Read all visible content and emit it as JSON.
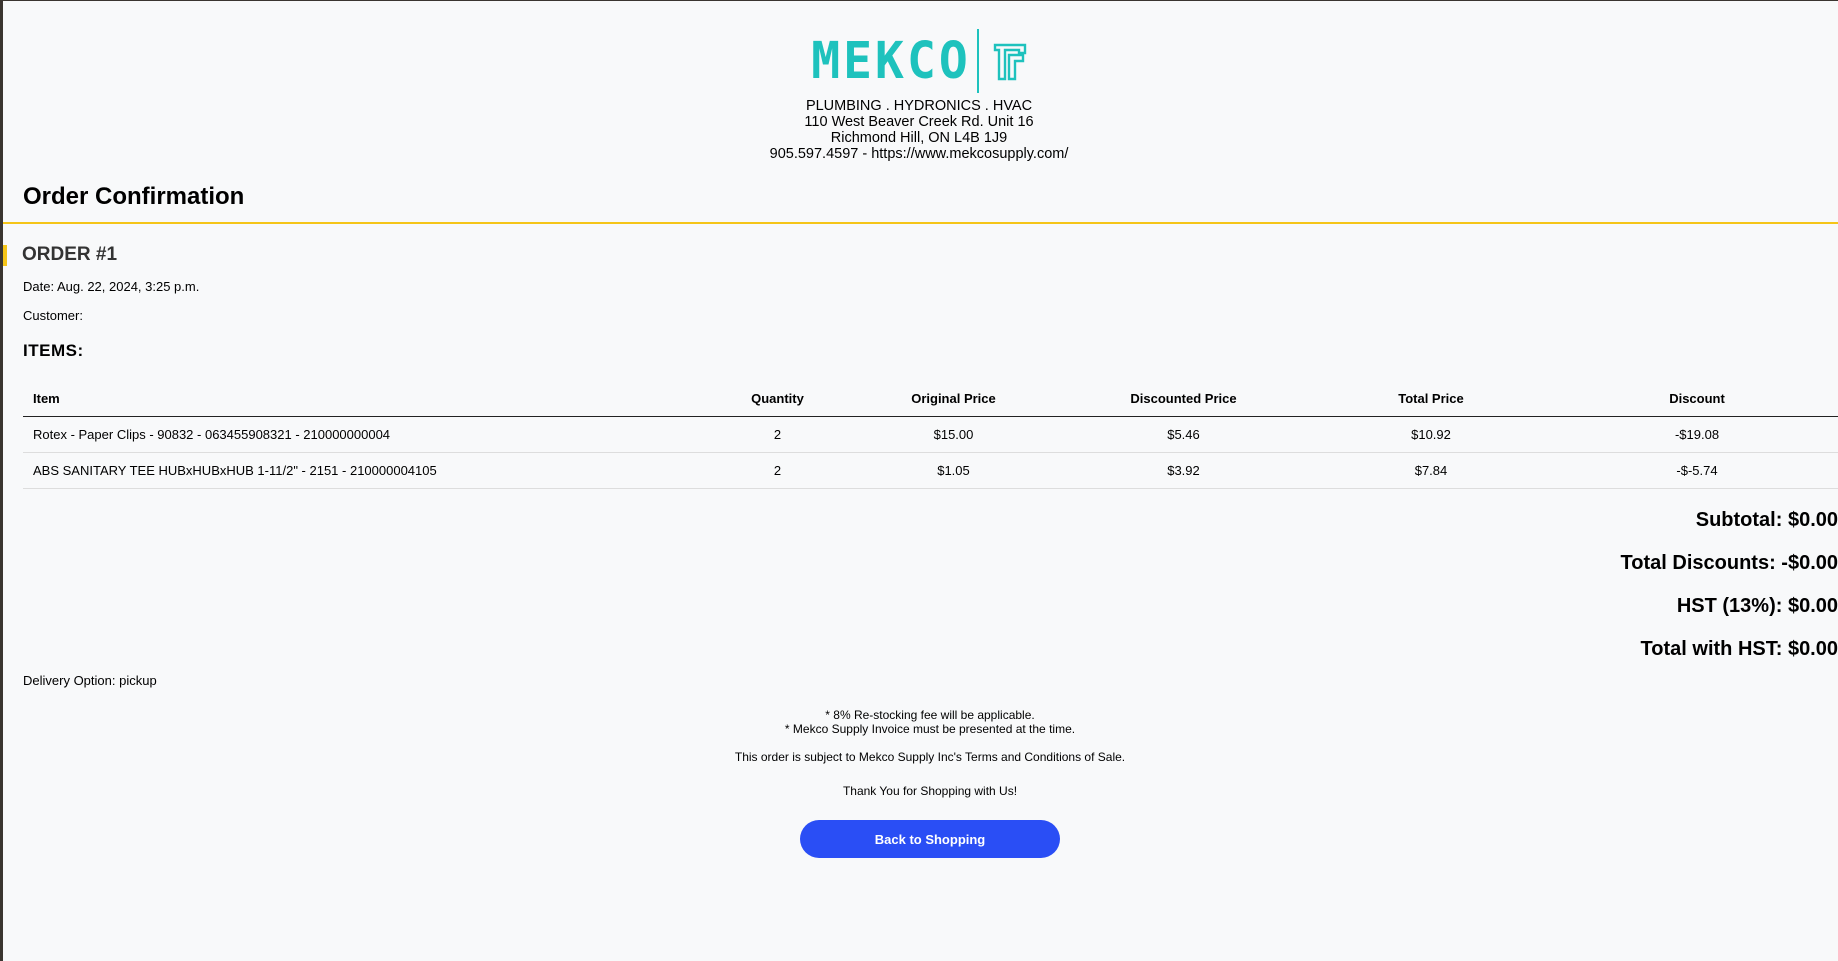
{
  "company": {
    "logo_text": "MEKCO",
    "brand_color": "#1ec2bd",
    "address_lines": [
      "PLUMBING . HYDRONICS . HVAC",
      "110 West Beaver Creek Rd. Unit 16",
      "Richmond Hill, ON L4B 1J9",
      "905.597.4597 - https://www.mekcosupply.com/"
    ]
  },
  "page_title": "Order Confirmation",
  "order": {
    "heading": "ORDER #1",
    "date": "Date: Aug. 22, 2024, 3:25 p.m.",
    "customer": "Customer:"
  },
  "items_heading": "ITEMS:",
  "table": {
    "headers": [
      "Item",
      "Quantity",
      "Original Price",
      "Discounted Price",
      "Total Price",
      "Discount"
    ],
    "rows": [
      [
        "Rotex - Paper Clips - 90832 - 063455908321 - 210000000004",
        "2",
        "$15.00",
        "$5.46",
        "$10.92",
        "-$19.08"
      ],
      [
        "ABS SANITARY TEE HUBxHUBxHUB 1-11/2\" - 2151 - 210000004105",
        "2",
        "$1.05",
        "$3.92",
        "$7.84",
        "-$-5.74"
      ]
    ]
  },
  "totals": {
    "subtotal": "Subtotal: $0.00",
    "total_discounts": "Total Discounts: -$0.00",
    "hst": "HST (13%): $0.00",
    "total_with_hst": "Total with HST: $0.00"
  },
  "delivery": "Delivery Option: pickup",
  "notes": {
    "restocking": "* 8% Re-stocking fee will be applicable.",
    "invoice": "* Mekco Supply Invoice must be presented at the time.",
    "terms": "This order is subject to Mekco Supply Inc's Terms and Conditions of Sale.",
    "thanks": "Thank You for Shopping with Us!"
  },
  "back_button_label": "Back to Shopping",
  "colors": {
    "accent": "#f5c518",
    "button": "#2a4ef5"
  }
}
